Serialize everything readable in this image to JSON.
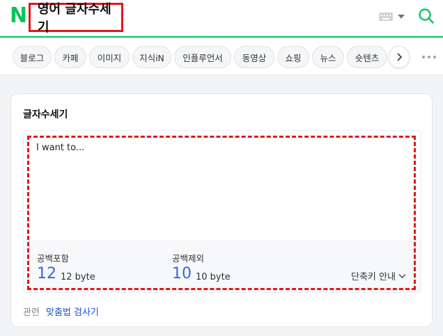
{
  "header": {
    "logo_letter": "N",
    "search_query": "영어 글자수세기",
    "brand_color": "#03c75a"
  },
  "tabs": [
    {
      "label": "블로그"
    },
    {
      "label": "카페"
    },
    {
      "label": "이미지"
    },
    {
      "label": "지식iN"
    },
    {
      "label": "인플루언서"
    },
    {
      "label": "동영상"
    },
    {
      "label": "쇼핑"
    },
    {
      "label": "뉴스"
    },
    {
      "label": "숏텐츠"
    }
  ],
  "card": {
    "title": "글자수세기",
    "input_value": "I want to...",
    "with_spaces": {
      "label": "공백포함",
      "count": "12",
      "bytes": "12 byte"
    },
    "without_spaces": {
      "label": "공백제외",
      "count": "10",
      "bytes": "10 byte"
    },
    "shortcut_label": "단축키 안내",
    "related_prefix": "관련",
    "related_link": "맞춤법 검사기",
    "highlight_color": "#e0181b",
    "count_color": "#2d6ae0"
  }
}
